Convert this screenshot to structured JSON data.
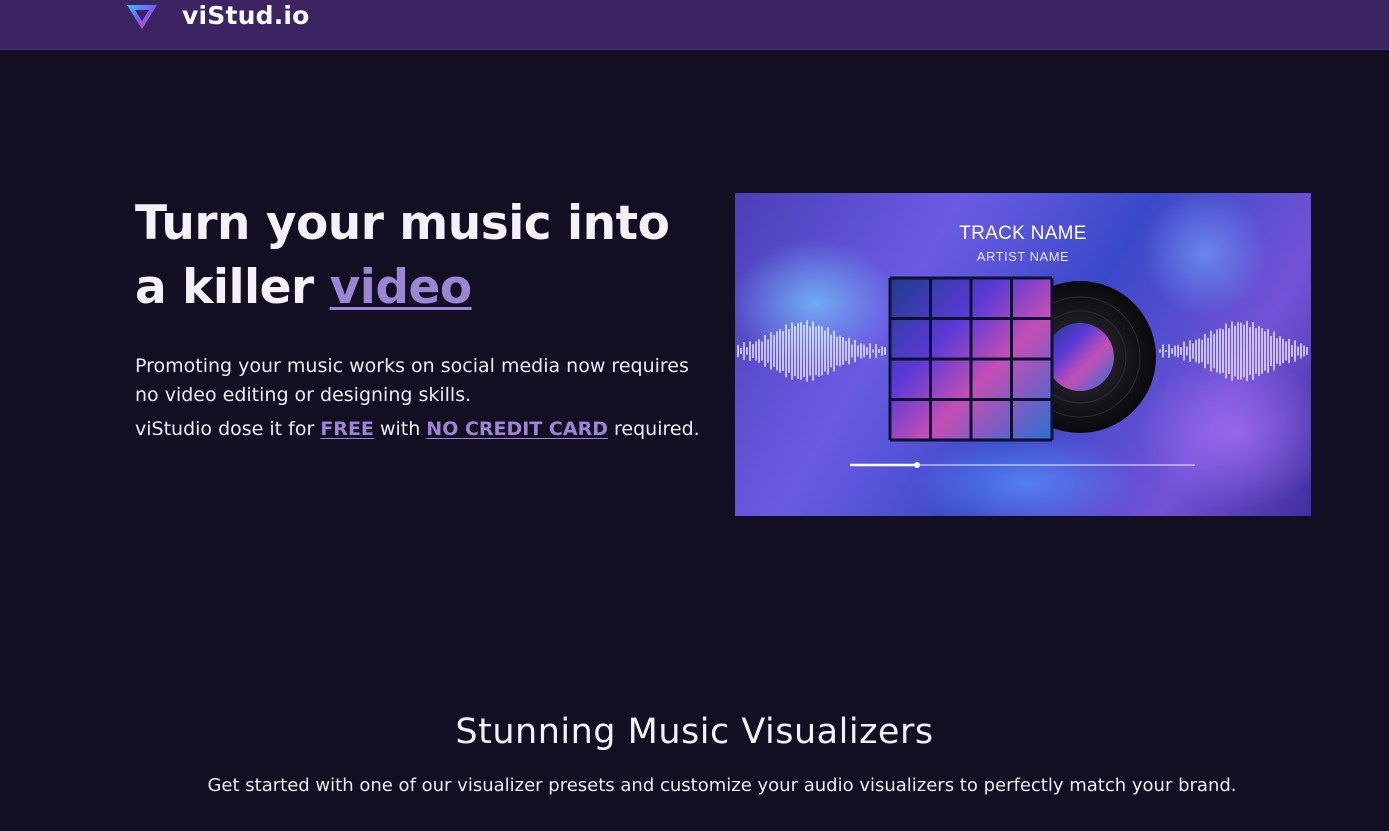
{
  "header": {
    "brand": "viStud.io"
  },
  "hero": {
    "title_prefix": "Turn your music into a killer ",
    "title_link": "video",
    "description": "Promoting your music works on social media now requires no video editing or designing skills.",
    "line2_prefix": "viStudio dose it for ",
    "free_link": "FREE",
    "line2_mid": " with ",
    "no_card_link": "NO CREDIT CARD",
    "line2_suffix": " required."
  },
  "preview": {
    "track_name": "TRACK NAME",
    "artist_name": "ARTIST NAME"
  },
  "section": {
    "title": "Stunning Music Visualizers",
    "subtitle": "Get started with one of our visualizer presets and customize your audio visualizers to perfectly match your brand."
  },
  "colors": {
    "background": "#120f22",
    "header": "#3b2461",
    "accent": "#9b86d6"
  }
}
